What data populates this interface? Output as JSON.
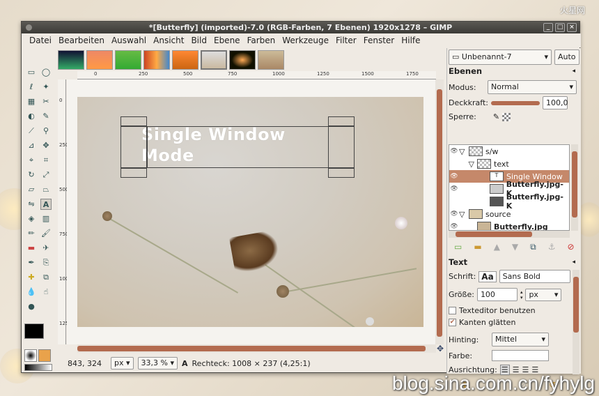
{
  "window": {
    "title": "*[Butterfly] (imported)-7.0 (RGB-Farben, 7 Ebenen) 1920x1278 – GIMP"
  },
  "menu": [
    "Datei",
    "Bearbeiten",
    "Auswahl",
    "Ansicht",
    "Bild",
    "Ebene",
    "Farben",
    "Werkzeuge",
    "Filter",
    "Fenster",
    "Hilfe"
  ],
  "ruler": {
    "h_ticks": [
      "0",
      "250",
      "500",
      "750",
      "1000",
      "1250",
      "1500",
      "1750"
    ],
    "v_ticks": [
      "0",
      "250",
      "500",
      "750",
      "1000",
      "1250"
    ]
  },
  "canvas_text": {
    "line1": "Single Window",
    "line2": "Mode"
  },
  "status": {
    "coords": "843, 324",
    "unit": "px",
    "zoom": "33,3 %",
    "info": "Rechteck: 1008 × 237  (4,25:1)"
  },
  "dock": {
    "image_select": "Unbenannt-7",
    "auto_label": "Auto",
    "layers_title": "Ebenen",
    "mode_label": "Modus:",
    "mode_value": "Normal",
    "opacity_label": "Deckkraft:",
    "opacity_value": "100,0",
    "lock_label": "Sperre:",
    "layers": [
      {
        "name": "s/w",
        "indent": 1,
        "bold": false,
        "selected": false
      },
      {
        "name": "text",
        "indent": 2,
        "bold": false,
        "selected": false
      },
      {
        "name": "Single Window",
        "indent": 3,
        "bold": false,
        "selected": true
      },
      {
        "name": "Butterfly.jpg-K",
        "indent": 3,
        "bold": true,
        "selected": false
      },
      {
        "name": "Butterfly.jpg-K",
        "indent": 3,
        "bold": true,
        "selected": false
      },
      {
        "name": "source",
        "indent": 1,
        "bold": false,
        "selected": false
      },
      {
        "name": "Butterfly.jpg",
        "indent": 2,
        "bold": true,
        "selected": false
      }
    ],
    "text_title": "Text",
    "font_label": "Schrift:",
    "font_value": "Sans Bold",
    "size_label": "Größe:",
    "size_value": "100",
    "size_unit": "px",
    "editor_label": "Texteditor benutzen",
    "antialias_label": "Kanten glätten",
    "hinting_label": "Hinting:",
    "hinting_value": "Mittel",
    "color_label": "Farbe:",
    "justify_label": "Ausrichtung:"
  },
  "watermark": "blog.sina.com.cn/fyhylg",
  "logo": "火星网"
}
